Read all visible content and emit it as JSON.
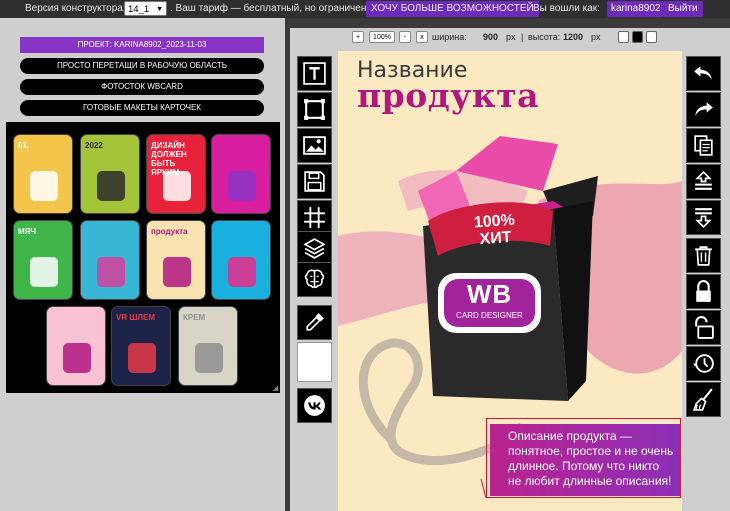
{
  "topbar": {
    "version_label": "Версия конструктора:",
    "version_value": "14_1",
    "plan_text": ". Ваш тариф — бесплатный, но ограниченный",
    "upgrade_label": "ХОЧУ БОЛЬШЕ ВОЗМОЖНОСТЕЙ",
    "login_label": "Вы вошли как:",
    "username": "karina8902",
    "logout_label": "Выйти"
  },
  "left_panel": {
    "project_label": "ПРОЕКТ:   KARINA8902_2023-11-03",
    "buttons": [
      "ПРОСТО ПЕРЕТАЩИ В РАБОЧУЮ ОБЛАСТЬ",
      "ФОТОСТОК WBCARD",
      "ГОТОВЫЕ МАКЕТЫ КАРТОЧЕК"
    ],
    "thumbnails": [
      {
        "text": "01.",
        "bg": "#f3c54a",
        "accent": "#ffffff"
      },
      {
        "text": "2022",
        "bg": "#a6c43a",
        "accent": "#2d2d2d"
      },
      {
        "text": "ДИЗАЙН ДОЛЖЕН БЫТЬ ЯРКИМ",
        "bg": "#e8223a",
        "accent": "#ffffff"
      },
      {
        "text": "",
        "bg": "#d91fa0",
        "accent": "#8a35c6"
      },
      {
        "text": "МЯЧ",
        "bg": "#3fb54a",
        "accent": "#ffffff"
      },
      {
        "text": "",
        "bg": "#39b5d6",
        "accent": "#d63f9b"
      },
      {
        "text": "продукта",
        "bg": "#f8e3b0",
        "accent": "#b0187f"
      },
      {
        "text": "",
        "bg": "#19b0e0",
        "accent": "#ea2a8d"
      },
      {
        "text": "",
        "bg": "#f7c3d4",
        "accent": "#b0187f"
      },
      {
        "text": "VR ШЛЕМ",
        "bg": "#1d2348",
        "accent": "#e63a4a"
      },
      {
        "text": "КРЕМ",
        "bg": "#d9d4c8",
        "accent": "#8e8e8e"
      }
    ]
  },
  "zoom": {
    "plus": "+",
    "level": "100%",
    "minus": "-",
    "close": "x",
    "width_label": "ширина:",
    "width_value": "900",
    "height_label": "высота:",
    "height_value": "1200",
    "unit": "px",
    "separator": "|"
  },
  "left_tools": [
    "text-tool-icon",
    "frame-tool-icon",
    "image-tool-icon",
    "save-icon",
    "grid-icon",
    "layers-icon",
    "brain-icon",
    "eyedropper-icon",
    "color-swatch",
    "vk-icon"
  ],
  "right_tools": [
    "undo-icon",
    "redo-icon",
    "copy-icon",
    "bring-forward-icon",
    "send-backward-icon",
    "trash-icon",
    "lock-icon",
    "unlock-icon",
    "history-icon",
    "broom-icon"
  ],
  "card": {
    "title_line1": "Название",
    "title_line2": "продукта",
    "badge_line1": "100%",
    "badge_line2": "ХИТ",
    "logo_text": "WB",
    "logo_sub": "CARD DESIGNER",
    "description": "Описание продукта — понятное, простое и не очень длинное. Потому что никто не любит длинные описания!"
  },
  "colors": {
    "accent_purple": "#8534c4",
    "brand_magenta": "#b0187f",
    "card_bg": "#fbe9c2"
  }
}
